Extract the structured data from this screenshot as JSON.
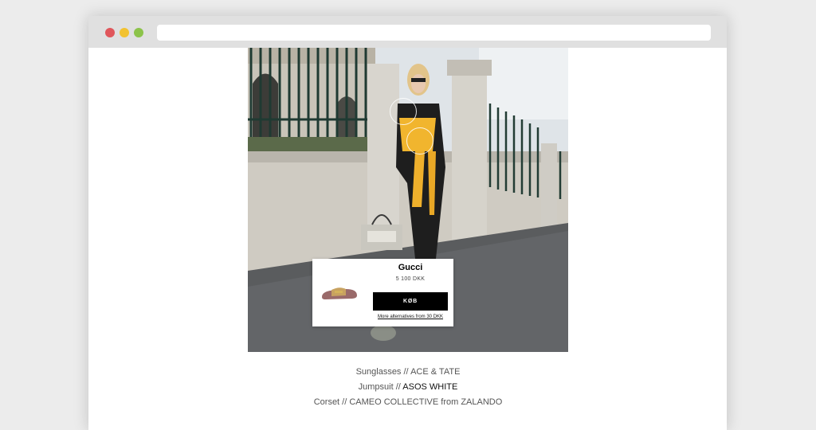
{
  "browser": {
    "url": ""
  },
  "popup": {
    "brand": "Gucci",
    "price": "5 100 DKK",
    "buy_label": "KØB",
    "alternatives_link": "More alternatives from 30 DKK"
  },
  "credits": [
    {
      "item": "Sunglasses // ",
      "brand": "ACE & TATE",
      "highlight": false
    },
    {
      "item": "Jumpsuit // ",
      "brand": "ASOS WHITE",
      "highlight": true
    },
    {
      "item": "Corset // ",
      "brand": "CAMEO COLLECTIVE from ZALANDO",
      "highlight": false
    }
  ],
  "icons": [
    "close-dot",
    "minimize-dot",
    "maximize-dot"
  ],
  "colors": {
    "close": "#e0565b",
    "minimize": "#f2c230",
    "maximize": "#8cc34a",
    "buy_button": "#000000"
  }
}
